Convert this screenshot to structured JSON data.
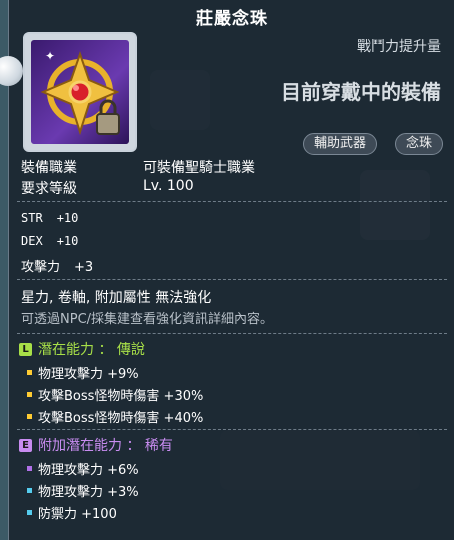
{
  "item": {
    "name": "莊嚴念珠",
    "power_label": "戰鬥力提升量",
    "equipped_label": "目前穿戴中的裝備",
    "tags": [
      "輔助武器",
      "念珠"
    ]
  },
  "requirements": [
    {
      "label": "裝備職業",
      "value": "可裝備聖騎士職業"
    },
    {
      "label": "要求等級",
      "value": "Lv. 100"
    }
  ],
  "stats": [
    {
      "label": "STR",
      "value": "+10"
    },
    {
      "label": "DEX",
      "value": "+10"
    },
    {
      "label": "攻擊力",
      "value": "+3"
    }
  ],
  "notes": {
    "restrictions": "星力, 卷軸, 附加屬性 無法強化",
    "hint": "可透過NPC/採集建查看強化資訊詳細內容。"
  },
  "potential": {
    "badge": "L",
    "title": "潛在能力 ： 傳說",
    "color": "#a8e048",
    "lines": [
      "物理攻擊力 +9%",
      "攻擊Boss怪物時傷害 +30%",
      "攻擊Boss怪物時傷害 +40%"
    ],
    "dot_color": "#ffcc33"
  },
  "bonus_potential": {
    "badge": "E",
    "title": "附加潛在能力 ： 稀有",
    "color": "#c88cf0",
    "lines": [
      "物理攻擊力 +6%",
      "物理攻擊力 +3%",
      "防禦力 +100"
    ],
    "dot_colors": [
      "#b070e8",
      "#55ccee",
      "#55ccee"
    ]
  }
}
